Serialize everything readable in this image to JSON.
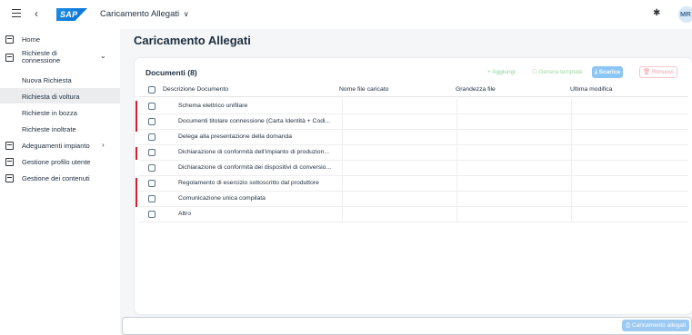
{
  "shell": {
    "logo_text": "SAP",
    "app_title": "Caricamento Allegati",
    "title_chevron": "∨",
    "back_glyph": "‹",
    "settings_glyph": "✱",
    "avatar_initials": "MR"
  },
  "sidebar": {
    "items": [
      {
        "label": "Home"
      },
      {
        "label": "Richieste di connessione",
        "arrow": "⌄"
      },
      {
        "label": "Nuova Richiesta"
      },
      {
        "label": "Richiesta di voltura"
      },
      {
        "label": "Richieste in bozza"
      },
      {
        "label": "Richieste inoltrate"
      },
      {
        "label": "Adeguamenti impianto",
        "arrow": "›"
      },
      {
        "label": "Gestione profilo utente"
      },
      {
        "label": "Gestione dei contenuti"
      }
    ],
    "label_line1": "Richieste di",
    "label_line2": "connessione"
  },
  "page": {
    "title": "Caricamento Allegati"
  },
  "documents": {
    "title": "Documenti (8)",
    "toolbar": {
      "aggiungi": "+ Aggiungi",
      "genera": "⎔ Genera template",
      "scarica": "⤓ Scarica",
      "rimuovi": "🗑 Rimuovi"
    },
    "columns": [
      "Descrizione Documento",
      "Nome file caricato",
      "Grandezza file",
      "Ultima modifica"
    ],
    "rows": [
      {
        "descrizione": "Schema elettrico unifilare"
      },
      {
        "descrizione": "Documenti titolare connessione (Carta Identità + Codi..."
      },
      {
        "descrizione": "Delega alla presentazione della domanda"
      },
      {
        "descrizione": "Dichiarazione di conformità dell'impianto di produzion..."
      },
      {
        "descrizione": "Dichiarazione di conformità dei dispositivi di conversio..."
      },
      {
        "descrizione": "Regolamento di esercizio sottoscritto dal produttore"
      },
      {
        "descrizione": "Comunicazione unica compilata"
      },
      {
        "descrizione": "Altro"
      }
    ],
    "marker_color": "#d61f2c"
  },
  "footer": {
    "carica_label": "⎙ Caricamento allegati"
  }
}
